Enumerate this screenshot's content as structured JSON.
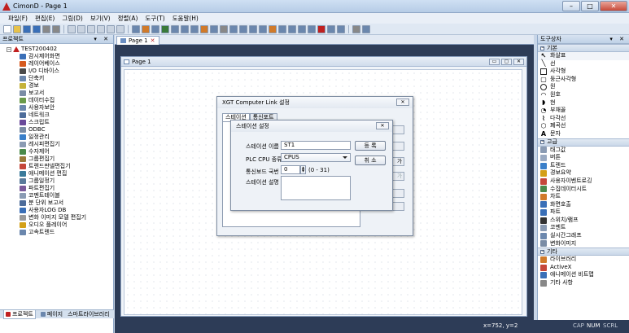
{
  "window": {
    "title": "CimonD - Page 1",
    "min": "–",
    "max": "□",
    "close": "✕"
  },
  "menu": [
    "파일(F)",
    "편집(E)",
    "그림(D)",
    "보기(V)",
    "정렬(A)",
    "도구(T)",
    "도움말(H)"
  ],
  "project_panel": {
    "title": "프로젝트",
    "pin": "▾ ✕",
    "root": "TEST200402",
    "items": [
      {
        "label": "감시제어화면",
        "color": "#3a6fb7"
      },
      {
        "label": "레이어베이스",
        "color": "#d65a1e"
      },
      {
        "label": "I/O 디바이스",
        "color": "#4a4a4a"
      },
      {
        "label": "단축키",
        "color": "#6b87ad"
      },
      {
        "label": "경보",
        "color": "#c5b23a"
      },
      {
        "label": "보고서",
        "color": "#7a8ca5"
      },
      {
        "label": "데이터수집",
        "color": "#6a9a4a"
      },
      {
        "label": "사용자보안",
        "color": "#6b87ad"
      },
      {
        "label": "네트워크",
        "color": "#4d6c9a"
      },
      {
        "label": "스크립트",
        "color": "#6a4a9a"
      },
      {
        "label": "ODBC",
        "color": "#7a8ca5"
      },
      {
        "label": "일정관리",
        "color": "#3a7fc9"
      },
      {
        "label": "레시피편집기",
        "color": "#8a9bb3"
      },
      {
        "label": "수자제어",
        "color": "#4a8a4a"
      },
      {
        "label": "그룹편집기",
        "color": "#9a7a3a"
      },
      {
        "label": "트렌드판넬편집기",
        "color": "#c5473a"
      },
      {
        "label": "애니메이션 편집",
        "color": "#3a7a9a"
      },
      {
        "label": "그룹일정기",
        "color": "#5a7a9a"
      },
      {
        "label": "파트편집기",
        "color": "#7a5a9a"
      },
      {
        "label": "코멘트테이블",
        "color": "#8a9bb3"
      },
      {
        "label": "분 단위 보고서",
        "color": "#4d6c9a"
      },
      {
        "label": "사용자LOG DB",
        "color": "#3a6fb7"
      },
      {
        "label": "변화 이미지 모델 편집기",
        "color": "#9a9a9a"
      },
      {
        "label": "오디오 플레이어",
        "color": "#d4a017"
      },
      {
        "label": "고속트렌드",
        "color": "#6b87ad"
      }
    ],
    "tabs": [
      "프로젝트",
      "페이지",
      "스마트라이브러리"
    ]
  },
  "document": {
    "tab_label": "Page 1",
    "tab_close": "✕",
    "page_window_title": "Page 1",
    "page_btns": [
      "▭",
      "▢",
      "✕"
    ]
  },
  "xgt_dialog": {
    "title": "XGT Computer Link 설정",
    "close": "✕",
    "tabs": [
      "스테이션",
      "통신포트"
    ],
    "side_buttons": [
      "",
      "",
      "",
      "",
      "가",
      "가"
    ]
  },
  "station_dialog": {
    "title": "스테이션 설정",
    "close": "✕",
    "name_label": "스테이션 이름",
    "name_value": "ST1",
    "cpu_label": "PLC CPU 종류",
    "cpu_value": "CPUS",
    "addr_label": "통신보드 국번",
    "addr_value": "0",
    "addr_range": "(0 - 31)",
    "desc_label": "스테이션 설명",
    "register_btn": "등 록",
    "cancel_btn": "취 소"
  },
  "toolbox": {
    "title": "도구상자",
    "pin": "▾ ✕",
    "sections": [
      {
        "name": "기본",
        "items": [
          {
            "label": "화살표",
            "icon": "arrow-icon"
          },
          {
            "label": "선",
            "icon": "line-icon"
          },
          {
            "label": "사각형",
            "icon": "rect-icon"
          },
          {
            "label": "둥근사각형",
            "icon": "rounded-rect-icon"
          },
          {
            "label": "원",
            "icon": "circle-icon"
          },
          {
            "label": "원호",
            "icon": "arc-icon"
          },
          {
            "label": "현",
            "icon": "chord-icon"
          },
          {
            "label": "부채꼴",
            "icon": "pie-icon"
          },
          {
            "label": "다각선",
            "icon": "polyline-icon"
          },
          {
            "label": "폐곡선",
            "icon": "polygon-icon"
          },
          {
            "label": "문자",
            "icon": "text-icon"
          }
        ]
      },
      {
        "name": "고급",
        "items": [
          {
            "label": "태그값",
            "icon": "tag-icon"
          },
          {
            "label": "버튼",
            "icon": "button-icon"
          },
          {
            "label": "트렌드",
            "icon": "trend-icon"
          },
          {
            "label": "경보요약",
            "icon": "alarm-icon"
          },
          {
            "label": "사용자이벤트로깅",
            "icon": "event-icon"
          },
          {
            "label": "수집데이터시트",
            "icon": "sheet-icon"
          },
          {
            "label": "차트",
            "icon": "chart-icon"
          },
          {
            "label": "화면호출",
            "icon": "screen-icon"
          },
          {
            "label": "파트",
            "icon": "part-icon"
          },
          {
            "label": "스위치/램프",
            "icon": "switch-icon"
          },
          {
            "label": "코멘트",
            "icon": "comment-icon"
          },
          {
            "label": "실시간그래프",
            "icon": "graph-icon"
          },
          {
            "label": "변화이미지",
            "icon": "image-icon"
          }
        ]
      },
      {
        "name": "기타",
        "items": [
          {
            "label": "라이브러리",
            "icon": "library-icon"
          },
          {
            "label": "ActiveX",
            "icon": "activex-icon"
          },
          {
            "label": "애니메이션 비트맵",
            "icon": "anim-icon"
          },
          {
            "label": "기타 사항",
            "icon": "misc-icon"
          }
        ]
      }
    ]
  },
  "status": {
    "coords": "x=752, y=2",
    "caps": "CAP",
    "num": "NUM",
    "scrl": "SCRL"
  },
  "colors": {
    "workspace": "#2d3c57",
    "accent": "#c02020"
  }
}
